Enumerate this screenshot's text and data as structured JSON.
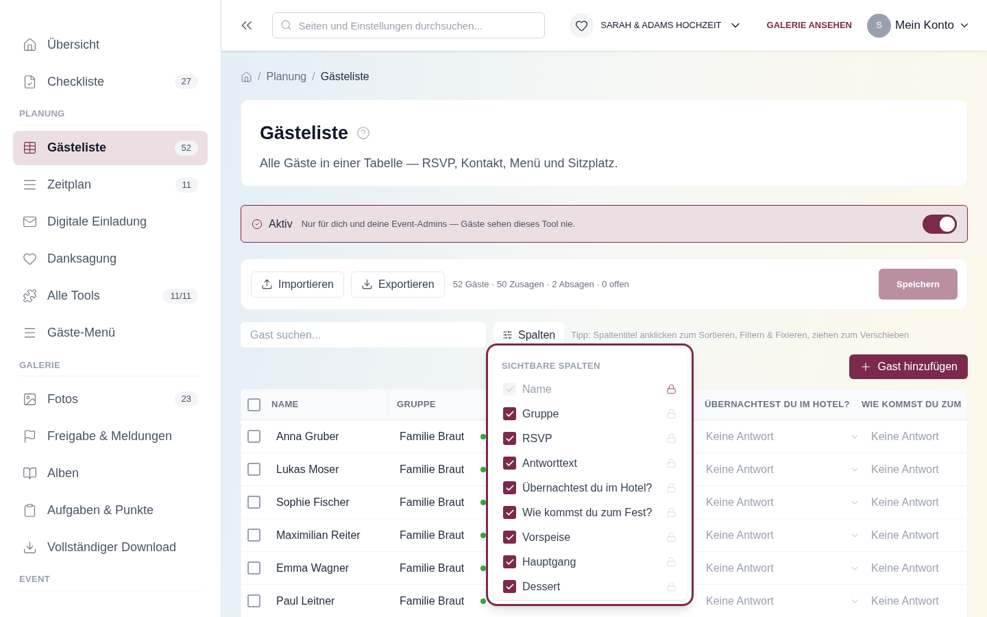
{
  "sidebar": {
    "sections": [
      {
        "items": [
          {
            "label": "Übersicht",
            "selected": false
          },
          {
            "label": "Checkliste",
            "badge": "27",
            "selected": false
          }
        ]
      },
      {
        "heading": "PLANUNG",
        "items": [
          {
            "label": "Gästeliste",
            "badge": "52",
            "selected": true
          },
          {
            "label": "Zeitplan",
            "badge": "11",
            "selected": false
          },
          {
            "label": "Digitale Einladung",
            "selected": false
          },
          {
            "label": "Danksagung",
            "selected": false
          },
          {
            "label": "Alle Tools",
            "badge": "11/11",
            "selected": false
          },
          {
            "label": "Gäste-Menü",
            "selected": false
          }
        ]
      },
      {
        "heading": "GALERIE",
        "items": [
          {
            "label": "Fotos",
            "badge": "23",
            "selected": false
          },
          {
            "label": "Freigabe & Meldungen",
            "selected": false
          },
          {
            "label": "Alben",
            "selected": false
          },
          {
            "label": "Aufgaben & Punkte",
            "selected": false
          },
          {
            "label": "Vollständiger Download",
            "selected": false
          }
        ]
      },
      {
        "heading": "EVENT"
      }
    ]
  },
  "topbar": {
    "search": {
      "placeholder": "Seiten und Einstellungen durchsuchen..."
    },
    "event": "SARAH & ADAMS HOCHZEIT",
    "gallery_link": "GALERIE ANSEHEN",
    "avatar": "S",
    "account": "Mein Konto"
  },
  "breadcrumb": [
    {
      "separator": "/",
      "label": "Planung"
    },
    {
      "separator": "/",
      "label": "Gästeliste"
    }
  ],
  "page": {
    "title": "Gästeliste",
    "subtitle": "Alle Gäste in einer Tabelle — RSVP, Kontakt, Menü und Sitzplatz."
  },
  "notice": {
    "label": "Aktiv",
    "text": "Nur für dich und deine Event-Admins — Gäste sehen dieses Tool nie.",
    "on": true
  },
  "toolbar": {
    "import": "Importieren",
    "export": "Exportieren",
    "summary": "52 Gäste · 50 Zusagen · 2 Absagen · 0 offen",
    "save": "Speichern",
    "save_disabled": true
  },
  "filter": {
    "placeholder": "Gast suchen...",
    "columns_button": "Spalten",
    "tip": "Tipp: Spaltentitel anklicken zum Sortieren, Filtern & Fixieren, ziehen zum Verschieben"
  },
  "add_button": "Gast hinzufügen",
  "table": {
    "select_all_checked": false,
    "columns": [
      "NAME",
      "GRUPPE",
      "ÜBERNACHTEST DU IM HOTEL?",
      "WIE KOMMST DU ZUM"
    ],
    "rows": [
      {
        "name": "Anna Gruber",
        "group": "Familie Braut",
        "color": "#3aa541",
        "hotel": "Keine Antwort",
        "travel": "Keine Antwort",
        "checked": false
      },
      {
        "name": "Lukas Moser",
        "group": "Familie Braut",
        "color": "#3aa541",
        "hotel": "Keine Antwort",
        "travel": "Keine Antwort",
        "checked": false
      },
      {
        "name": "Sophie Fischer",
        "group": "Familie Braut",
        "color": "#3aa541",
        "hotel": "Keine Antwort",
        "travel": "Keine Antwort",
        "checked": false
      },
      {
        "name": "Maximilian Reiter",
        "group": "Familie Braut",
        "color": "#3aa541",
        "hotel": "Keine Antwort",
        "travel": "Keine Antwort",
        "checked": false
      },
      {
        "name": "Emma Wagner",
        "group": "Familie Braut",
        "color": "#3aa541",
        "hotel": "Keine Antwort",
        "travel": "Keine Antwort",
        "checked": false
      },
      {
        "name": "Paul Leitner",
        "group": "Familie Braut",
        "color": "#3aa541",
        "hotel": "Keine Antwort",
        "travel": "Keine Antwort",
        "checked": false
      }
    ]
  },
  "columns_menu": {
    "heading": "SICHTBARE SPALTEN",
    "items": [
      {
        "label": "Name",
        "checked": true,
        "disabled": true,
        "locked": true
      },
      {
        "label": "Gruppe",
        "checked": true,
        "disabled": false,
        "locked": false
      },
      {
        "label": "RSVP",
        "checked": true,
        "disabled": false,
        "locked": false
      },
      {
        "label": "Antworttext",
        "checked": true,
        "disabled": false,
        "locked": false
      },
      {
        "label": "Übernachtest du im Hotel?",
        "checked": true,
        "disabled": false,
        "locked": false
      },
      {
        "label": "Wie kommst du zum Fest?",
        "checked": true,
        "disabled": false,
        "locked": false
      },
      {
        "label": "Vorspeise",
        "checked": true,
        "disabled": false,
        "locked": false
      },
      {
        "label": "Hauptgang",
        "checked": true,
        "disabled": false,
        "locked": false
      },
      {
        "label": "Dessert",
        "checked": true,
        "disabled": false,
        "locked": false
      }
    ]
  }
}
